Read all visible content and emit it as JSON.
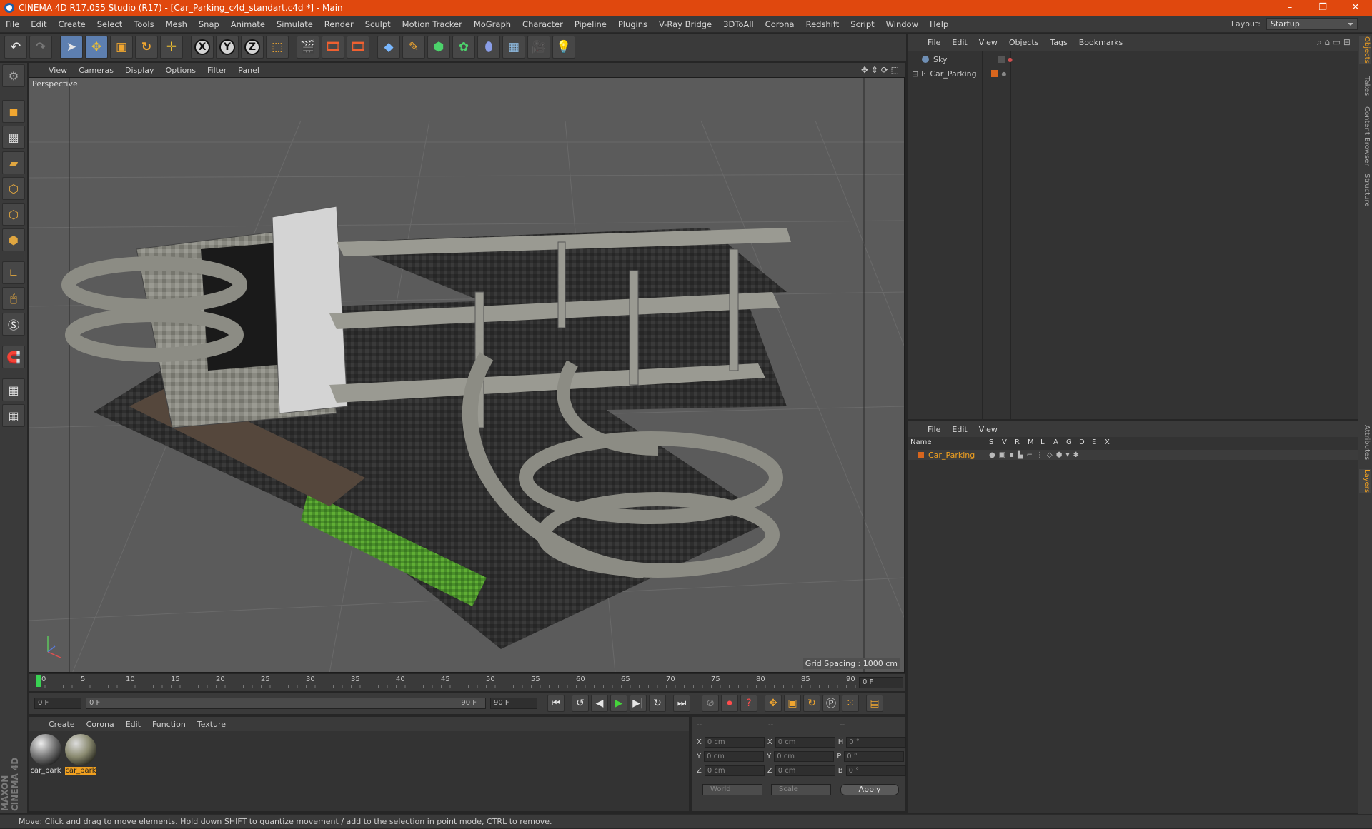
{
  "window": {
    "title": "CINEMA 4D R17.055 Studio (R17) - [Car_Parking_c4d_standart.c4d *] - Main",
    "controls": [
      "–",
      "❐",
      "✕"
    ]
  },
  "menubar": {
    "items": [
      "File",
      "Edit",
      "Create",
      "Select",
      "Tools",
      "Mesh",
      "Snap",
      "Animate",
      "Simulate",
      "Render",
      "Sculpt",
      "Motion Tracker",
      "MoGraph",
      "Character",
      "Pipeline",
      "Plugins",
      "V-Ray Bridge",
      "3DToAll",
      "Corona",
      "Redshift",
      "Script",
      "Window",
      "Help"
    ],
    "layout_label": "Layout:",
    "layout_value": "Startup"
  },
  "toolbar": {
    "axes": [
      "X",
      "Y",
      "Z"
    ]
  },
  "viewport": {
    "menu": [
      "View",
      "Cameras",
      "Display",
      "Options",
      "Filter",
      "Panel"
    ],
    "label": "Perspective",
    "grid_spacing": "Grid Spacing : 1000 cm"
  },
  "timeline": {
    "ticks": [
      "0",
      "5",
      "10",
      "15",
      "20",
      "25",
      "30",
      "35",
      "40",
      "45",
      "50",
      "55",
      "60",
      "65",
      "70",
      "75",
      "80",
      "85",
      "90"
    ],
    "current_frame": "0 F",
    "start_field": "0 F",
    "range_start": "0 F",
    "range_end": "90 F",
    "end_field": "90 F"
  },
  "material_manager": {
    "menu": [
      "Create",
      "Corona",
      "Edit",
      "Function",
      "Texture"
    ],
    "materials": [
      {
        "name": "car_park",
        "selected": false
      },
      {
        "name": "car_park",
        "selected": true
      }
    ]
  },
  "coordinates": {
    "headers": [
      "--",
      "--",
      "--"
    ],
    "rows": [
      {
        "a": "X",
        "av": "0 cm",
        "b": "X",
        "bv": "0 cm",
        "c": "H",
        "cv": "0 °"
      },
      {
        "a": "Y",
        "av": "0 cm",
        "b": "Y",
        "bv": "0 cm",
        "c": "P",
        "cv": "0 °"
      },
      {
        "a": "Z",
        "av": "0 cm",
        "b": "Z",
        "bv": "0 cm",
        "c": "B",
        "cv": "0 °"
      }
    ],
    "world": "World",
    "scale": "Scale",
    "apply": "Apply"
  },
  "object_manager": {
    "menu": [
      "File",
      "Edit",
      "View",
      "Objects",
      "Tags",
      "Bookmarks"
    ],
    "objects": [
      {
        "name": "Sky",
        "color": "#6f8fb5"
      },
      {
        "name": "Car_Parking",
        "color": "#d8661e"
      }
    ]
  },
  "layer_manager": {
    "menu": [
      "File",
      "Edit",
      "View"
    ],
    "columns": [
      "Name",
      "S",
      "V",
      "R",
      "M",
      "L",
      "A",
      "G",
      "D",
      "E",
      "X"
    ],
    "layers": [
      {
        "name": "Car_Parking",
        "color": "#d8661e"
      }
    ]
  },
  "side_tabs": {
    "top": [
      "Objects",
      "Takes",
      "Content Browser",
      "Structure"
    ],
    "bottom": [
      "Attributes",
      "Layers"
    ]
  },
  "brand": "MAXON CINEMA 4D",
  "status": "Move: Click and drag to move elements. Hold down SHIFT to quantize movement / add to the selection in point mode, CTRL to remove.",
  "colors": {
    "accent": "#e0480e",
    "selection": "#f0a020"
  }
}
